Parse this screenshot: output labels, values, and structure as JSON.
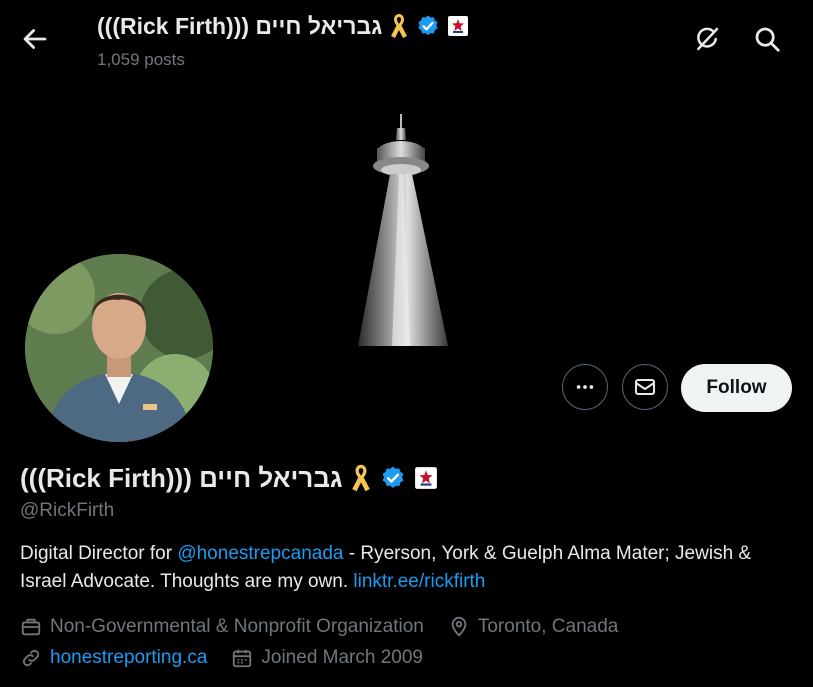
{
  "header": {
    "display_name": "(((Rick Firth))) גבריאל חיים",
    "posts_count": "1,059 posts"
  },
  "profile": {
    "display_name": "(((Rick Firth))) גבריאל חיים",
    "handle": "@RickFirth",
    "bio_prefix": "Digital Director for ",
    "bio_mention": "@honestrepcanada",
    "bio_middle": " - Ryerson, York & Guelph Alma Mater; Jewish & Israel Advocate. Thoughts are my own. ",
    "bio_link": "linktr.ee/rickfirth",
    "category": "Non-Governmental & Nonprofit Organization",
    "location": "Toronto, Canada",
    "website": "honestreporting.ca",
    "joined": "Joined March 2009"
  },
  "actions": {
    "follow_label": "Follow"
  },
  "colors": {
    "background": "#000000",
    "text": "#e7e9ea",
    "secondary": "#71767b",
    "link": "#1d9bf0",
    "verified": "#1d9bf0",
    "ribbon": "#f5c451"
  },
  "icons": {
    "back": "arrow-left-icon",
    "grok": "grok-icon",
    "search": "search-icon",
    "more": "more-dots-icon",
    "message": "envelope-icon",
    "category": "briefcase-icon",
    "location": "location-pin-icon",
    "website": "link-icon",
    "joined": "calendar-icon"
  }
}
